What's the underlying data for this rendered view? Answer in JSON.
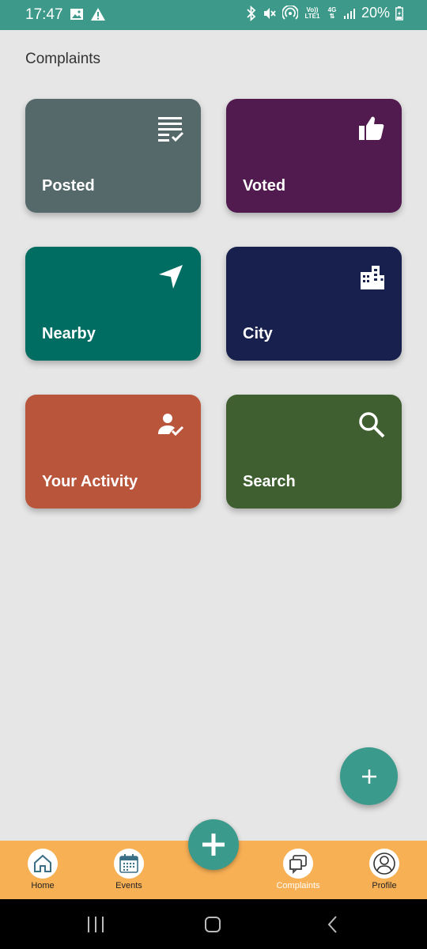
{
  "status_bar": {
    "time": "17:47",
    "battery": "20%",
    "net_top": "Vo)) LTE1",
    "net_4g": "4G",
    "left_icons": [
      "image-icon",
      "warning-icon"
    ],
    "right_icons": [
      "bluetooth-icon",
      "mute-icon",
      "hotspot-icon",
      "signal-icon",
      "battery-charging-icon"
    ]
  },
  "page": {
    "title": "Complaints"
  },
  "tiles": [
    {
      "label": "Posted",
      "icon": "list-check-icon",
      "color": "#55686a"
    },
    {
      "label": "Voted",
      "icon": "thumbs-up-icon",
      "color": "#521b4f"
    },
    {
      "label": "Nearby",
      "icon": "navigation-icon",
      "color": "#006d63"
    },
    {
      "label": "City",
      "icon": "city-icon",
      "color": "#18204e"
    },
    {
      "label": "Your Activity",
      "icon": "user-check-icon",
      "color": "#b9553b"
    },
    {
      "label": "Search",
      "icon": "search-icon",
      "color": "#3f5f30"
    }
  ],
  "fab": {
    "icon": "plus-icon",
    "color": "#3a9a8b"
  },
  "bottom_nav": {
    "background": "#f8b055",
    "items": [
      {
        "label": "Home",
        "icon": "home-icon"
      },
      {
        "label": "Events",
        "icon": "calendar-icon"
      },
      {
        "label": "Complaints",
        "icon": "complaints-icon",
        "active": true
      },
      {
        "label": "Profile",
        "icon": "profile-icon"
      }
    ],
    "center_icon": "plus-icon"
  },
  "system_nav": [
    "recents-icon",
    "home-button-icon",
    "back-icon"
  ]
}
